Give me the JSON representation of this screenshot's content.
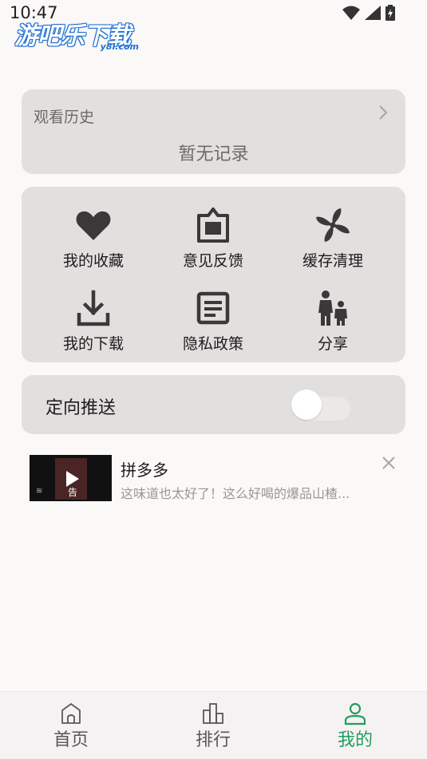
{
  "status_bar": {
    "time": "10:47"
  },
  "watermark": {
    "text": "游吧乐下载",
    "sub": "y8l.com"
  },
  "history": {
    "title": "观看历史",
    "empty_text": "暂无记录"
  },
  "grid": {
    "items": [
      {
        "label": "我的收藏",
        "icon": "heart-icon"
      },
      {
        "label": "意见反馈",
        "icon": "feedback-icon"
      },
      {
        "label": "缓存清理",
        "icon": "fan-icon"
      },
      {
        "label": "我的下载",
        "icon": "download-icon"
      },
      {
        "label": "隐私政策",
        "icon": "document-icon"
      },
      {
        "label": "分享",
        "icon": "share-people-icon"
      }
    ]
  },
  "push": {
    "label": "定向推送",
    "enabled": false
  },
  "ad": {
    "title": "拼多多",
    "description": "这味道也太好了！这么好喝的爆品山楂...",
    "badge": "告"
  },
  "bottom_nav": {
    "items": [
      {
        "label": "首页",
        "icon": "home-icon",
        "active": false
      },
      {
        "label": "排行",
        "icon": "ranking-icon",
        "active": false
      },
      {
        "label": "我的",
        "icon": "profile-icon",
        "active": true
      }
    ]
  },
  "colors": {
    "accent": "#1f9e5f",
    "card_bg": "#e2dfdf",
    "page_bg": "#fbf8f8",
    "icon_dark": "#3a3838"
  }
}
